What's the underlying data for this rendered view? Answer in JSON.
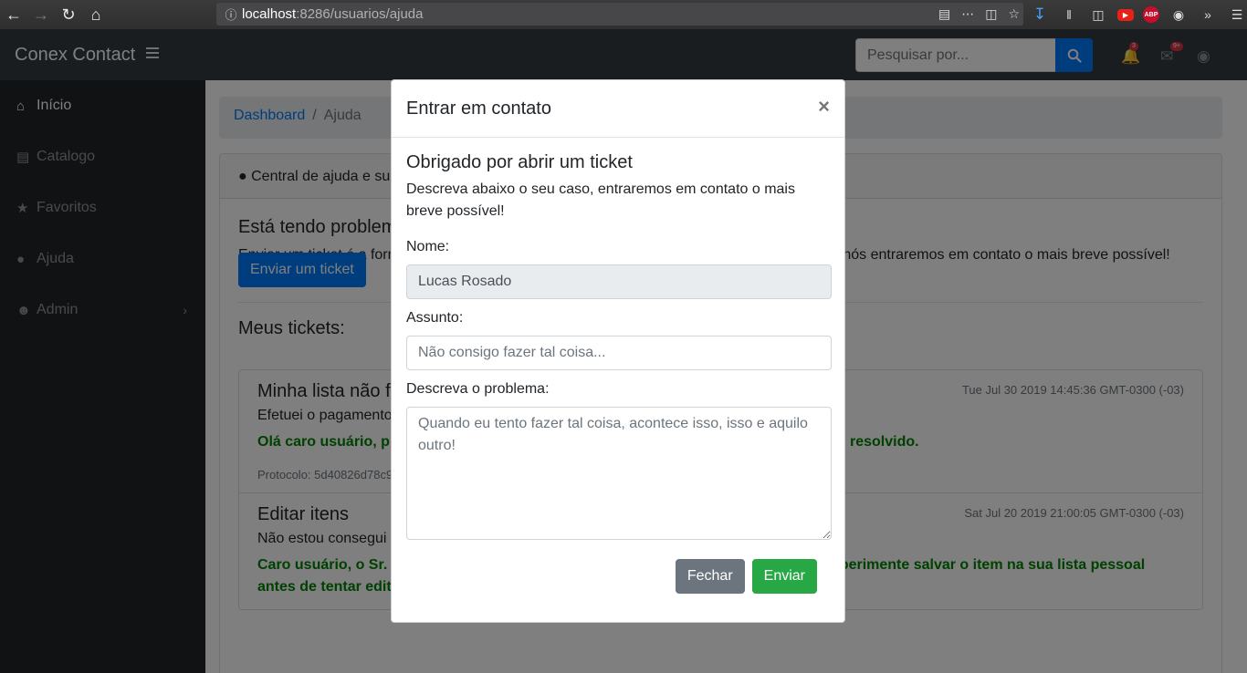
{
  "browser": {
    "url_host": "localhost",
    "url_path": ":8286/usuarios/ajuda"
  },
  "navbar": {
    "brand": "Conex Contact",
    "search_placeholder": "Pesquisar por...",
    "alerts_badge": "3",
    "messages_badge": "9+"
  },
  "sidebar": {
    "items": [
      {
        "label": "Início",
        "icon": "home-icon"
      },
      {
        "label": "Catalogo",
        "icon": "id-card-icon"
      },
      {
        "label": "Favoritos",
        "icon": "star-icon"
      },
      {
        "label": "Ajuda",
        "icon": "lightbulb-icon"
      },
      {
        "label": "Admin",
        "icon": "user-icon"
      }
    ]
  },
  "breadcrumb": {
    "link": "Dashboard",
    "separator": "/",
    "current": "Ajuda"
  },
  "page": {
    "card_header": "Central de ajuda e su",
    "heading": "Está tendo problem",
    "lead_left": "Enviar um ticket é a form",
    "lead_right": "e nós entraremos em contato o mais breve possível!",
    "send_ticket_button": "Enviar um ticket",
    "my_tickets": "Meus tickets:",
    "tickets": [
      {
        "title": "Minha lista não f",
        "date": "Tue Jul 30 2019 14:45:36 GMT-0300 (-03)",
        "desc": "Efetuei o pagamento",
        "reply_left": "Olá caro usuário, p",
        "reply_right": "resolvido.",
        "protocol": "Protocolo: 5d40826d78c9"
      },
      {
        "title": "Editar itens",
        "date": "Sat Jul 20 2019 21:00:05 GMT-0300 (-03)",
        "desc": "Não estou consegui",
        "reply_line1_left": "Caro usuário, o Sr.",
        "reply_line1_right": "experimente salvar o item na sua lista pessoal",
        "reply_line2": "antes de tentar editar."
      }
    ]
  },
  "modal": {
    "title": "Entrar em contato",
    "close": "×",
    "heading": "Obrigado por abrir um ticket",
    "description": "Descreva abaixo o seu caso, entraremos em contato o mais breve possível!",
    "name_label": "Nome:",
    "name_value": "Lucas Rosado",
    "subject_label": "Assunto:",
    "subject_placeholder": "Não consigo fazer tal coisa...",
    "problem_label": "Descreva o problema:",
    "problem_placeholder": "Quando eu tento fazer tal coisa, acontece isso, isso e aquilo outro!",
    "close_button": "Fechar",
    "send_button": "Enviar"
  },
  "colors": {
    "primary": "#007bff",
    "success": "#28a745",
    "secondary": "#6c757d",
    "navbar": "#343a40",
    "sidebar": "#212529"
  }
}
